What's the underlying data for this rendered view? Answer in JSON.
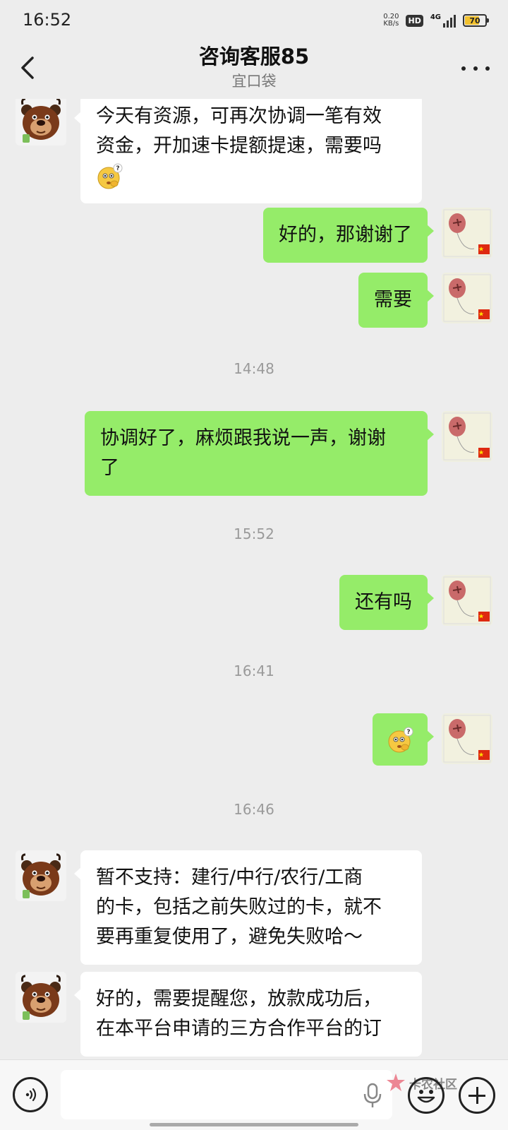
{
  "status_bar": {
    "time": "16:52",
    "net_speed_value": "0.20",
    "net_speed_unit": "KB/s",
    "hd": "HD",
    "network": "4G",
    "battery": "70"
  },
  "header": {
    "title": "咨询客服85",
    "subtitle": "宜口袋"
  },
  "messages": [
    {
      "from": "agent",
      "lines": [
        "今天有资源，可再次协调一笔有效",
        "资金，开加速卡提额提速，需要吗"
      ],
      "emoji": "thinking-emoji"
    },
    {
      "from": "me",
      "text": "好的，那谢谢了"
    },
    {
      "from": "me",
      "text": "需要"
    },
    {
      "type": "time",
      "text": "14:48"
    },
    {
      "from": "me",
      "lines": [
        "协调好了，麻烦跟我说一声，谢谢",
        "了"
      ]
    },
    {
      "type": "time",
      "text": "15:52"
    },
    {
      "from": "me",
      "text": "还有吗"
    },
    {
      "type": "time",
      "text": "16:41"
    },
    {
      "from": "me",
      "emoji": "thinking-emoji"
    },
    {
      "type": "time",
      "text": "16:46"
    },
    {
      "from": "agent",
      "lines": [
        "暂不支持：建行/中行/农行/工商",
        "的卡，包括之前失败过的卡，就不",
        "要再重复使用了，避免失败哈～"
      ]
    },
    {
      "from": "agent",
      "lines": [
        "好的，需要提醒您，放款成功后，",
        "在本平台申请的三方合作平台的订"
      ]
    }
  ],
  "input_bar": {
    "watermark": "卡农社区"
  },
  "colors": {
    "background": "#ededed",
    "outgoing_bubble": "#95ec69",
    "incoming_bubble": "#ffffff",
    "battery": "#f2c12e"
  }
}
